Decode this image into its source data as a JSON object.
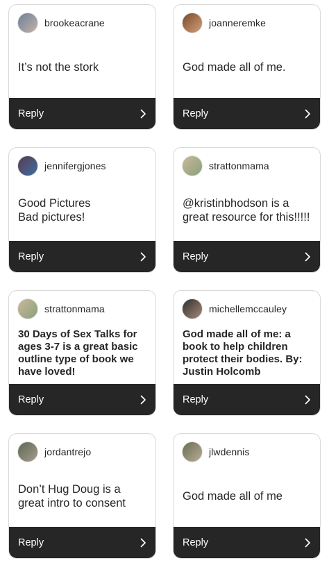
{
  "reply_label": "Reply",
  "cards": [
    {
      "username": "brookeacrane",
      "text": "It’s not the stork",
      "avatar_colors": [
        "#6d7f9a",
        "#c4b3a5"
      ]
    },
    {
      "username": "joanneremke",
      "text": "God made all of me.",
      "avatar_colors": [
        "#7a4a2a",
        "#d2a07b"
      ]
    },
    {
      "username": "jennifergjones",
      "text": "Good Pictures\nBad pictures!",
      "avatar_colors": [
        "#5b3a4f",
        "#3d6fa3"
      ]
    },
    {
      "username": "strattonmama",
      "text": "@kristinbhodson is a great resource for this!!!!!",
      "avatar_colors": [
        "#c9b89a",
        "#8aa07a"
      ]
    },
    {
      "username": "strattonmama",
      "text": "30 Days of Sex Talks for ages 3-7 is a great basic outline type  of book we have loved!",
      "avatar_colors": [
        "#c9b89a",
        "#8aa07a"
      ]
    },
    {
      "username": "michellemccauley",
      "text": "God made all of me: a book to help children protect their bodies. By: Justin Holcomb",
      "avatar_colors": [
        "#2f2f2f",
        "#a58a77"
      ]
    },
    {
      "username": "jordantrejo",
      "text": "Don’t Hug Doug is a great intro to consent",
      "avatar_colors": [
        "#5a6a52",
        "#a89a8c"
      ]
    },
    {
      "username": "jlwdennis",
      "text": "God made all of me",
      "avatar_colors": [
        "#6b6b52",
        "#b7ae98"
      ]
    }
  ],
  "colors": {
    "reply_bar": "#262626",
    "card_border": "#d9d9d9",
    "text": "#262626"
  },
  "icons": {
    "reply_arrow": "chevron-right-icon"
  }
}
